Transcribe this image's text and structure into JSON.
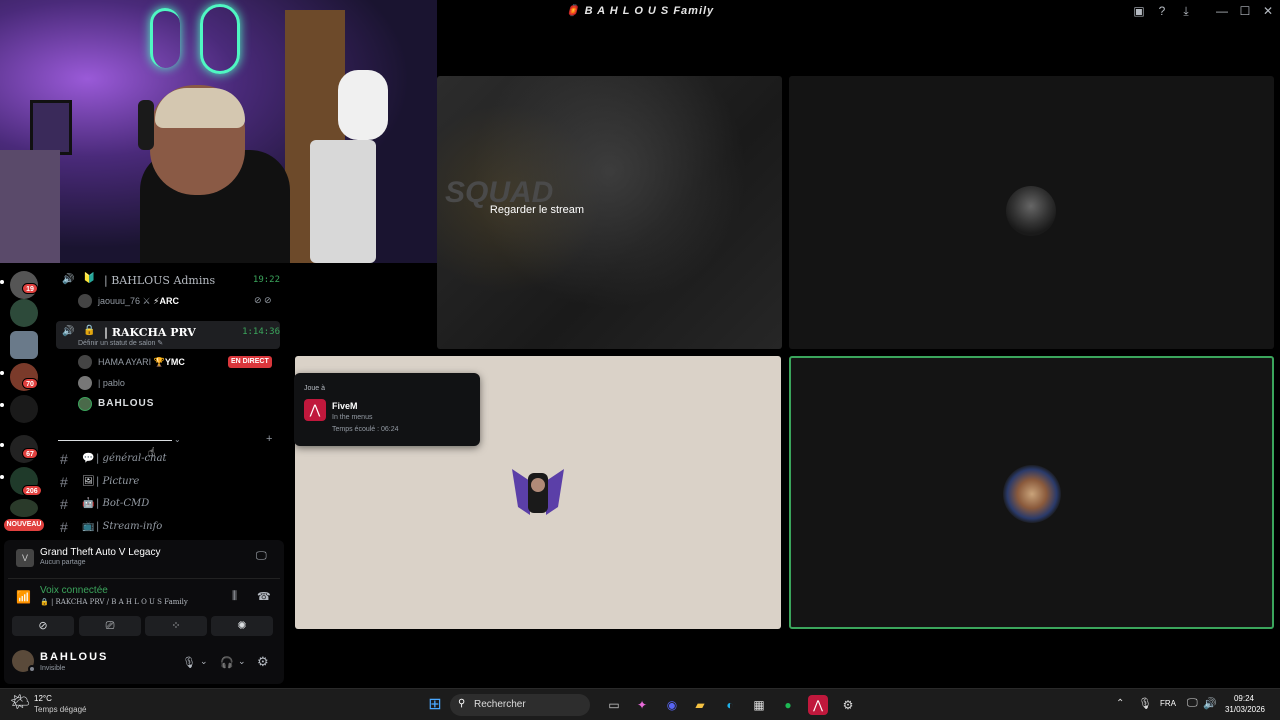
{
  "app": {
    "title": "B A H L O U S Family"
  },
  "stream": {
    "watch_label": "Regarder le stream"
  },
  "activity_card": {
    "heading": "Joue à",
    "game": "FiveM",
    "state": "In the menus",
    "elapsed": "Temps écoulé : 06:24"
  },
  "servers": {
    "badges": [
      "19",
      "70",
      "67",
      "206"
    ],
    "new_label": "NOUVEAU"
  },
  "voice_channels": [
    {
      "name": "| BAHLOUS Admins",
      "time": "19:22",
      "members": [
        {
          "name": "jaouuu_76 ⚔",
          "tag": "⚡ARC"
        }
      ]
    },
    {
      "name": "| RAKCHA PRV",
      "time": "1:14:36",
      "status_hint": "Définir un statut de salon ✎",
      "members": [
        {
          "name": "HAMA AYARI",
          "tag": "🏆YMC",
          "live": "EN DIRECT"
        },
        {
          "name": "| pablo"
        },
        {
          "name": "BAHLOUS"
        }
      ]
    }
  ],
  "text_channels": [
    {
      "emoji": "💬",
      "name": "| général-chat"
    },
    {
      "emoji": "🖼",
      "name": "| Picture"
    },
    {
      "emoji": "🤖",
      "name": "| Bot-CMD"
    },
    {
      "emoji": "📺",
      "name": "| Stream-info"
    }
  ],
  "activity_panel": {
    "game": "Grand Theft Auto V Legacy",
    "sub": "Aucun partage"
  },
  "voice_status": {
    "label": "Voix connectée",
    "channel": "| RAKCHA PRV / B A H L O U S Family"
  },
  "user": {
    "name": "BAHLOUS",
    "status": "Invisible"
  },
  "weather": {
    "temp": "12°C",
    "desc": "Temps dégagé"
  },
  "taskbar": {
    "search_placeholder": "Rechercher",
    "lang": "FRA",
    "time": "09:24",
    "date": "31/03/2026"
  },
  "colors": {
    "accent_green": "#3ba55c",
    "live_red": "#da373c",
    "badge_red": "#e1413f"
  }
}
